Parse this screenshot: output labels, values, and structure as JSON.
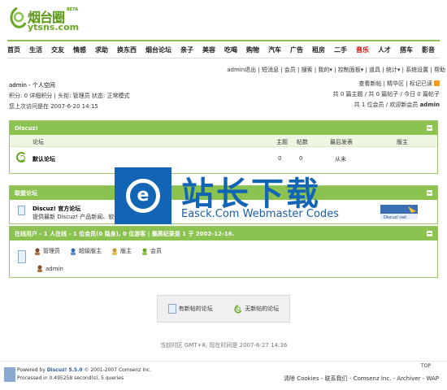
{
  "logo": {
    "cn": "烟台圈",
    "en": "ytsns.com",
    "beta": "BETA"
  },
  "nav": [
    {
      "label": "首页",
      "hot": false
    },
    {
      "label": "生活",
      "hot": false
    },
    {
      "label": "交友",
      "hot": false
    },
    {
      "label": "情感",
      "hot": false
    },
    {
      "label": "求助",
      "hot": false
    },
    {
      "label": "换东西",
      "hot": false
    },
    {
      "label": "烟台论坛",
      "hot": false
    },
    {
      "label": "亲子",
      "hot": false
    },
    {
      "label": "美容",
      "hot": false
    },
    {
      "label": "吃喝",
      "hot": false
    },
    {
      "label": "购物",
      "hot": false
    },
    {
      "label": "汽车",
      "hot": false
    },
    {
      "label": "广告",
      "hot": false
    },
    {
      "label": "租房",
      "hot": false
    },
    {
      "label": "二手",
      "hot": false
    },
    {
      "label": "音乐",
      "hot": true
    },
    {
      "label": "人才",
      "hot": false
    },
    {
      "label": "搭车",
      "hot": false
    },
    {
      "label": "影音",
      "hot": false
    }
  ],
  "userbar": "admin退出 | 短消息 | 会员 | 搜索 | 我的▾ | 控制面板▾ | 道具 | 统计▾ | 系统设置 | 帮助",
  "info": {
    "title": "admin - 个人空间",
    "line2": "积分: 0 详细积分 | 头衔: 管理员 状态: 正常模式",
    "line3": "您上次访问是在 2007-6-20 14:15"
  },
  "rinfo": {
    "line1": "查看新帖 | 精华区 | 标记已读",
    "line2": "共 0 篇主题 / 共 0 篇帖子 / 今日 0 篇帖子",
    "line3a": "共 1 位会员 / 欢迎新会员 ",
    "line3b": "admin"
  },
  "box1": {
    "title": "Discuz!",
    "cols": {
      "forum": "论坛",
      "topics": "主题",
      "posts": "帖数",
      "last": "最后发表",
      "mod": "版主"
    },
    "row": {
      "name": "默认论坛",
      "topics": "0",
      "posts": "0",
      "last": "从未"
    }
  },
  "box2": {
    "title": "联盟论坛",
    "name": "Discuz! 官方论坛",
    "desc": "提供最新 Discuz! 产品新闻、软件"
  },
  "box3": {
    "title": "在线用户 - 1 人在线 - 1 位会员(0 隐身), 0 位游客 | 最高纪录是 1 于 2002-12-16.",
    "legend": [
      "管理员",
      "超级版主",
      "版主",
      "会员"
    ],
    "user": "admin"
  },
  "legend": {
    "new": "有新帖的论坛",
    "nonew": "无新帖的论坛"
  },
  "timeline": "当前时区 GMT+8, 现在时间是 2007-6-27 14:36",
  "footer": {
    "powered": "Powered by ",
    "brand": "Discuz! 5.5.0",
    "copyright": " © 2001-2007 Comsenz Inc.",
    "processed": "Processed in 0.495258 second(s), 5 queries",
    "links": "清除 Cookies - 联系我们 - Comsenz Inc. - Archiver - WAP",
    "top": "TOP"
  },
  "watermark": {
    "cn": "站长下载",
    "en": "Easck.Com Webmaster Codes"
  },
  "colors": {
    "accent": "#8cc24f",
    "hot": "#c80000",
    "watermark": "#1264b5"
  }
}
